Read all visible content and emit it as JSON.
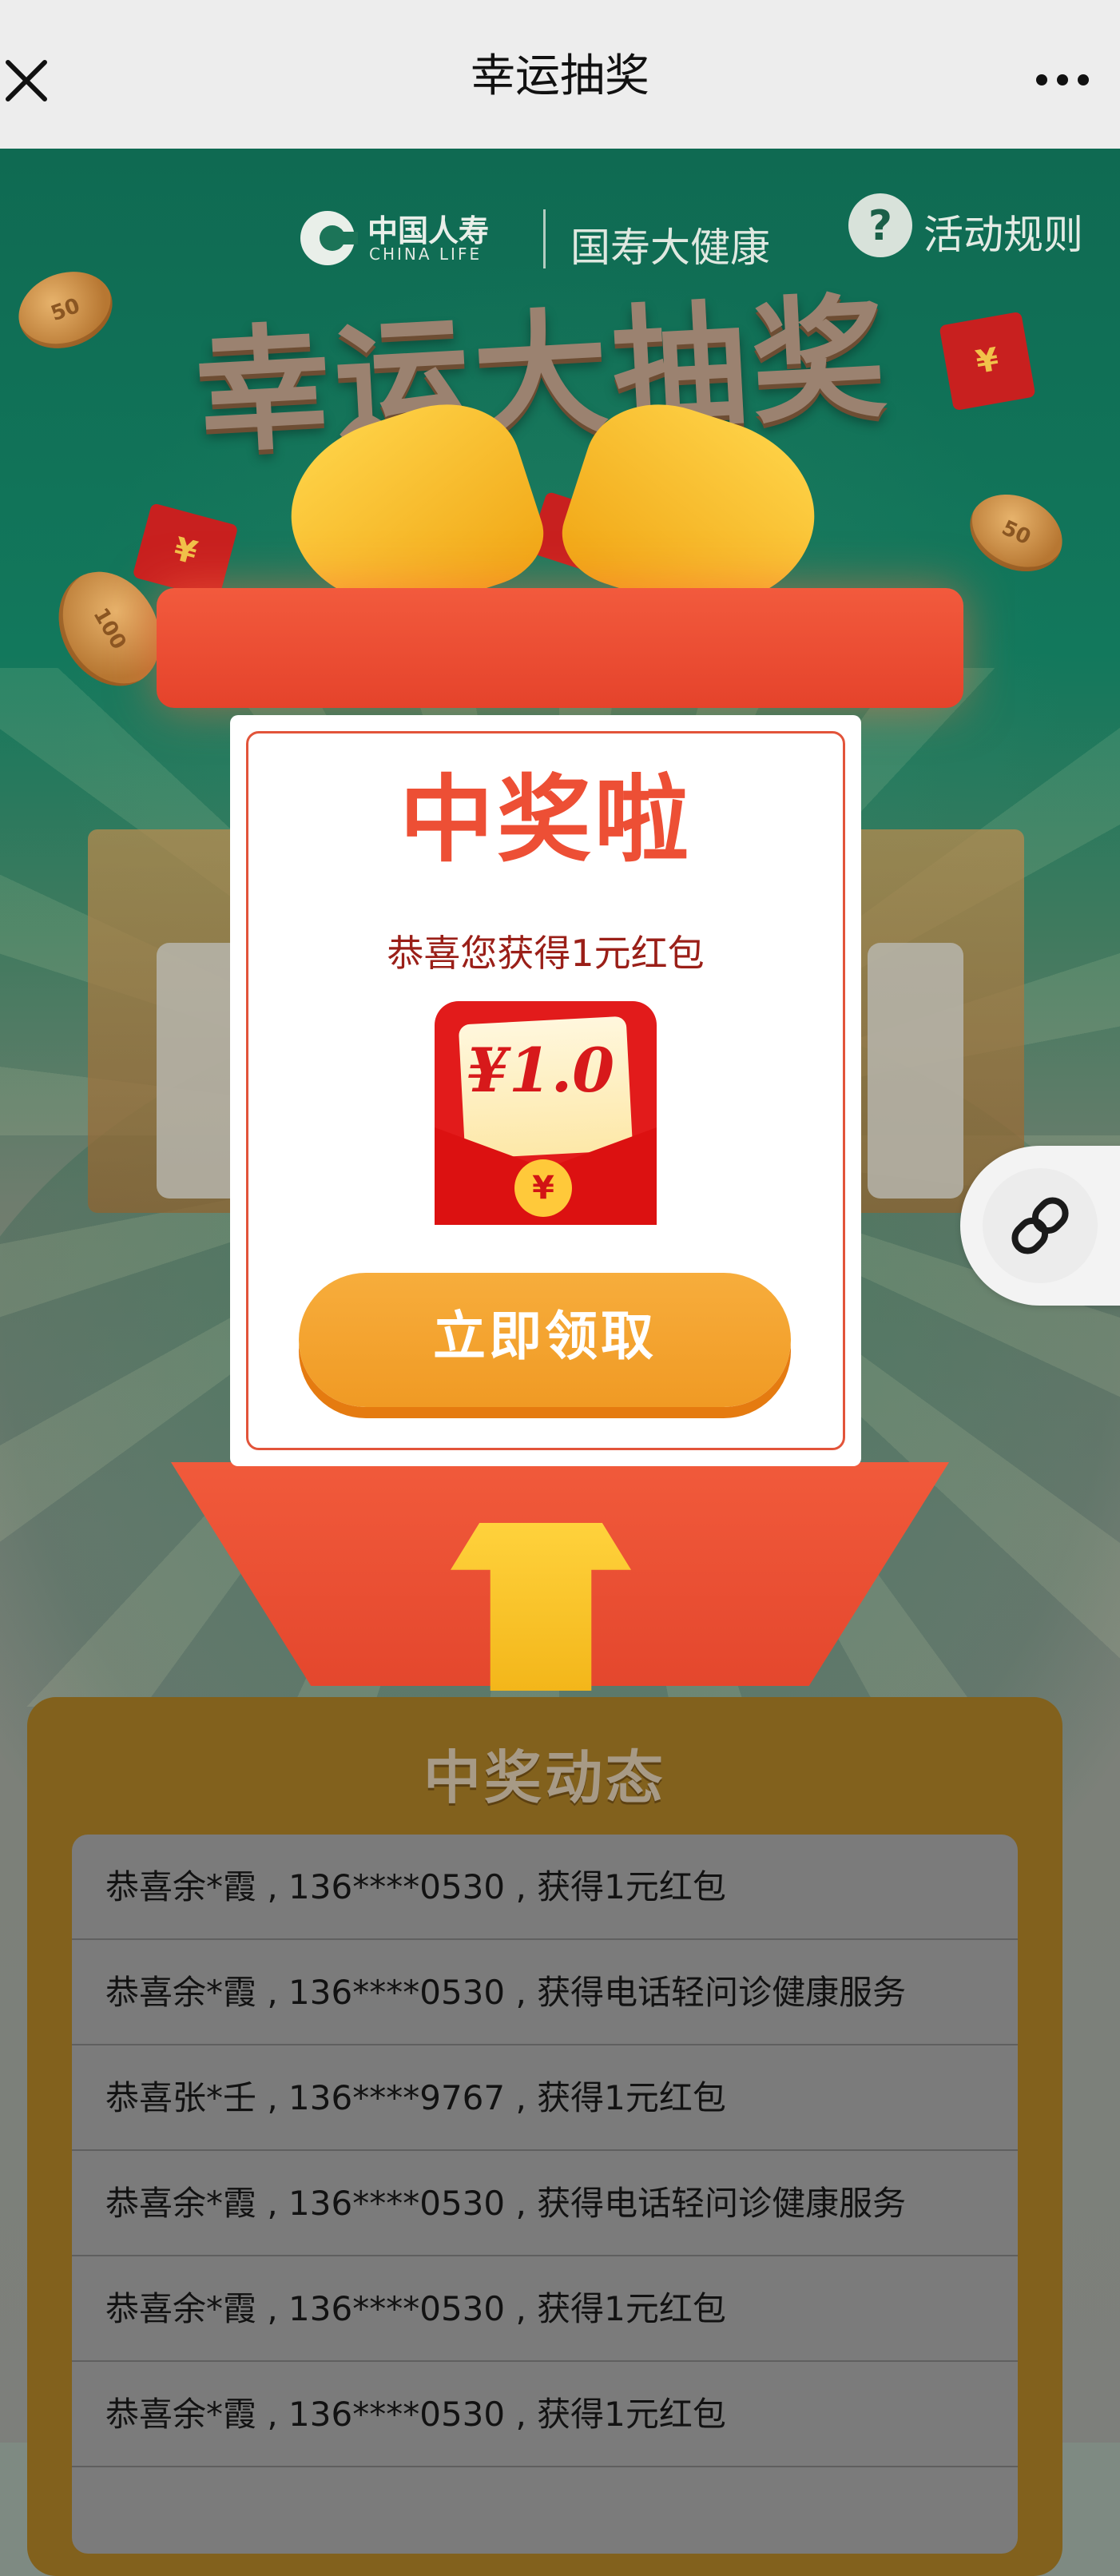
{
  "navbar": {
    "title": "幸运抽奖",
    "close_icon": "close-icon",
    "more_icon": "more-dots-icon"
  },
  "brand": {
    "logo_cn": "中国人寿",
    "logo_en": "CHINA LIFE",
    "sub_brand": "国寿大健康",
    "rules_label": "活动规则"
  },
  "hero": {
    "title": "幸运大抽奖"
  },
  "decor": {
    "coin_50": "50",
    "coin_100": "100",
    "yuan_symbol": "¥"
  },
  "modal": {
    "title": "中奖啦",
    "message": "恭喜您获得1元红包",
    "envelope_amount": "¥1.0",
    "envelope_seal": "¥",
    "claim_button": "立即领取"
  },
  "winners": {
    "title": "中奖动态",
    "items": [
      "恭喜余*霞 , 136****0530 , 获得1元红包",
      "恭喜余*霞 , 136****0530 , 获得电话轻问诊健康服务",
      "恭喜张*壬 , 136****9767 , 获得1元红包",
      "恭喜余*霞 , 136****0530 , 获得电话轻问诊健康服务",
      "恭喜余*霞 , 136****0530 , 获得1元红包",
      "恭喜余*霞 , 136****0530 , 获得1元红包"
    ]
  },
  "colors": {
    "primary_red": "#ed4f35",
    "button_orange": "#f7ad3c",
    "panel_brown": "#82611d",
    "nav_bg": "#ededed"
  },
  "fab": {
    "icon": "link-icon"
  }
}
